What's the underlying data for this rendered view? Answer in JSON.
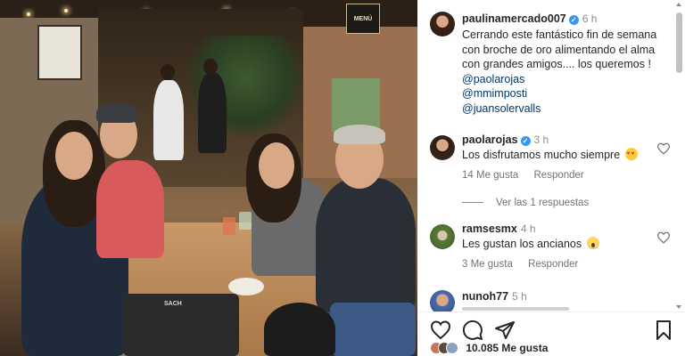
{
  "post": {
    "author": "paulinamercado007",
    "verified": true,
    "time": "6 h",
    "caption_line1": "Cerrando este fantástico fin de semana",
    "caption_line2": "con broche de oro alimentando el alma",
    "caption_line3": "con grandes amigos.... los queremos !",
    "mentions": [
      "@paolarojas",
      "@mmimposti",
      "@juansolervalls"
    ]
  },
  "photo": {
    "menu_sign": "MENÚ",
    "bag_label": "SACH"
  },
  "comments": [
    {
      "user": "paolarojas",
      "verified": true,
      "time": "3 h",
      "text": "Los disfrutamos mucho siempre",
      "emoji": "heart-eyes-emoji",
      "likes": "14 Me gusta",
      "reply": "Responder"
    },
    {
      "user": "ramsesmx",
      "verified": false,
      "time": "4 h",
      "text": "Les gustan los ancianos",
      "emoji": "screaming-face-emoji",
      "likes": "3 Me gusta",
      "reply": "Responder"
    },
    {
      "user": "nunoh77",
      "verified": false,
      "time": "5 h"
    }
  ],
  "view_replies": "Ver las 1 respuestas",
  "footer": {
    "likes_count": "10.085 Me gusta"
  },
  "icons": {
    "like": "heart-icon",
    "comment": "comment-icon",
    "share": "send-icon",
    "save": "bookmark-icon"
  },
  "colors": {
    "verified": "#3897f0",
    "mention": "#00376b",
    "muted": "#737373"
  }
}
